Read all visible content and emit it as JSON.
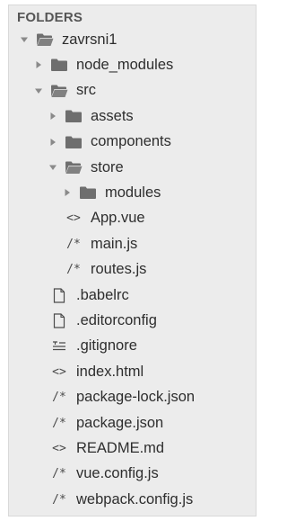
{
  "title": "FOLDERS",
  "colors": {
    "folder_fill": "#6e6e6e",
    "arrow": "#8a8a8a",
    "file_outline": "#4b4b4b"
  },
  "tree": [
    {
      "label": "zavrsni1",
      "type": "folder",
      "expanded": true,
      "depth": 0,
      "icon": "folder-open-icon"
    },
    {
      "label": "node_modules",
      "type": "folder",
      "expanded": false,
      "depth": 1,
      "icon": "folder-icon"
    },
    {
      "label": "src",
      "type": "folder",
      "expanded": true,
      "depth": 1,
      "icon": "folder-open-icon"
    },
    {
      "label": "assets",
      "type": "folder",
      "expanded": false,
      "depth": 2,
      "icon": "folder-icon"
    },
    {
      "label": "components",
      "type": "folder",
      "expanded": false,
      "depth": 2,
      "icon": "folder-icon"
    },
    {
      "label": "store",
      "type": "folder",
      "expanded": true,
      "depth": 2,
      "icon": "folder-open-icon"
    },
    {
      "label": "modules",
      "type": "folder",
      "expanded": false,
      "depth": 3,
      "icon": "folder-icon"
    },
    {
      "label": "App.vue",
      "type": "file",
      "depth": 2,
      "icon": "code-file-icon",
      "glyph": "<>"
    },
    {
      "label": "main.js",
      "type": "file",
      "depth": 2,
      "icon": "comment-file-icon",
      "glyph": "/*"
    },
    {
      "label": "routes.js",
      "type": "file",
      "depth": 2,
      "icon": "comment-file-icon",
      "glyph": "/*"
    },
    {
      "label": ".babelrc",
      "type": "file",
      "depth": 1,
      "icon": "document-file-icon"
    },
    {
      "label": ".editorconfig",
      "type": "file",
      "depth": 1,
      "icon": "document-file-icon"
    },
    {
      "label": ".gitignore",
      "type": "file",
      "depth": 1,
      "icon": "text-lines-icon"
    },
    {
      "label": "index.html",
      "type": "file",
      "depth": 1,
      "icon": "code-file-icon",
      "glyph": "<>"
    },
    {
      "label": "package-lock.json",
      "type": "file",
      "depth": 1,
      "icon": "comment-file-icon",
      "glyph": "/*"
    },
    {
      "label": "package.json",
      "type": "file",
      "depth": 1,
      "icon": "comment-file-icon",
      "glyph": "/*"
    },
    {
      "label": "README.md",
      "type": "file",
      "depth": 1,
      "icon": "code-file-icon",
      "glyph": "<>"
    },
    {
      "label": "vue.config.js",
      "type": "file",
      "depth": 1,
      "icon": "comment-file-icon",
      "glyph": "/*"
    },
    {
      "label": "webpack.config.js",
      "type": "file",
      "depth": 1,
      "icon": "comment-file-icon",
      "glyph": "/*"
    }
  ]
}
